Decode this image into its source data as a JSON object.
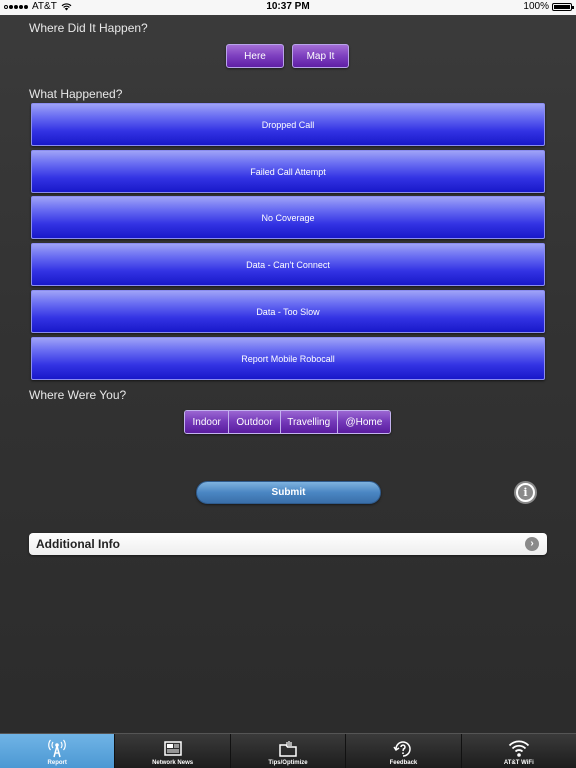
{
  "status_bar": {
    "carrier": "AT&T",
    "time": "10:37 PM",
    "battery": "100%",
    "battery_level": 1.0
  },
  "location_section": {
    "title": "Where Did It Happen?",
    "here_label": "Here",
    "map_label": "Map It"
  },
  "issue_section": {
    "title": "What Happened?",
    "options": [
      {
        "label": "Dropped Call"
      },
      {
        "label": "Failed Call Attempt"
      },
      {
        "label": "No Coverage"
      },
      {
        "label": "Data - Can't Connect"
      },
      {
        "label": "Data - Too Slow"
      },
      {
        "label": "Report Mobile Robocall"
      }
    ]
  },
  "place_section": {
    "title": "Where Were You?",
    "segments": [
      {
        "label": "Indoor"
      },
      {
        "label": "Outdoor"
      },
      {
        "label": "Travelling"
      },
      {
        "label": "@Home"
      }
    ]
  },
  "submit_label": "Submit",
  "info_glyph": "i",
  "additional_info": {
    "label": "Additional Info",
    "chevron": "›"
  },
  "tab_bar": {
    "tabs": [
      {
        "label": "Report",
        "icon": "antenna-icon",
        "active": true
      },
      {
        "label": "Network News",
        "icon": "newspaper-icon",
        "active": false
      },
      {
        "label": "Tips/Optimize",
        "icon": "folder-tools-icon",
        "active": false
      },
      {
        "label": "Feedback",
        "icon": "feedback-question-icon",
        "active": false
      },
      {
        "label": "AT&T WiFi",
        "icon": "wifi-icon",
        "active": false
      }
    ]
  },
  "colors": {
    "background": "#333333",
    "issue_button": "#3434e4",
    "segment_button": "#7338b8",
    "submit_button": "#4a86c3",
    "active_tab": "#5aa3db"
  }
}
